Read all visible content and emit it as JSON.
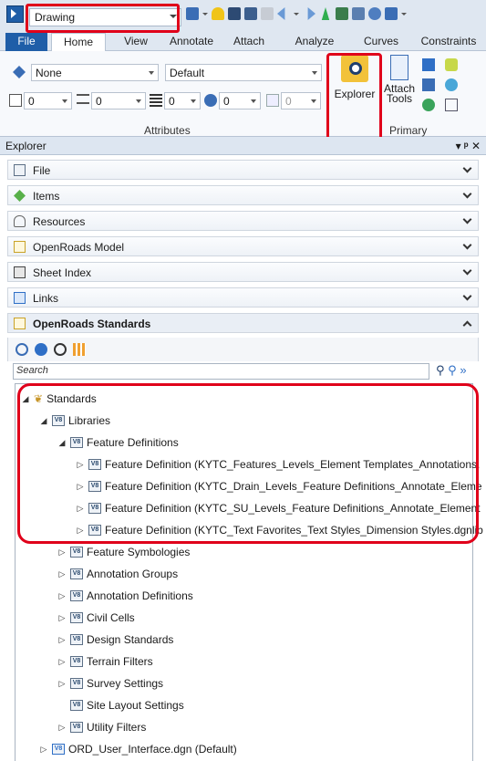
{
  "workspace": {
    "selected": "Drawing"
  },
  "ribbon_tabs": [
    "File",
    "Home",
    "View",
    "Annotate",
    "Attach",
    "Analyze",
    "Curves",
    "Constraints"
  ],
  "ribbon": {
    "level_value": "None",
    "style_value": "Default",
    "small_values": [
      "0",
      "0",
      "0",
      "0",
      "0"
    ],
    "group_attributes": "Attributes",
    "group_primary": "Primary",
    "explorer_label": "Explorer",
    "attach_tools_label1": "Attach",
    "attach_tools_label2": "Tools"
  },
  "explorer": {
    "title": "Explorer",
    "title_controls": "▾ ᵖ ✕",
    "sections": [
      "File",
      "Items",
      "Resources",
      "OpenRoads Model",
      "Sheet Index",
      "Links",
      "OpenRoads Standards"
    ],
    "search_placeholder": "Search"
  },
  "tree": {
    "root": "Standards",
    "libraries": "Libraries",
    "feature_definitions": "Feature Definitions",
    "fd_items": [
      "Feature Definition (KYTC_Features_Levels_Element Templates_Annotations.",
      "Feature Definition (KYTC_Drain_Levels_Feature Definitions_Annotate_Eleme",
      "Feature Definition (KYTC_SU_Levels_Feature Definitions_Annotate_Element",
      "Feature Definition (KYTC_Text Favorites_Text Styles_Dimension Styles.dgnlib"
    ],
    "other_libs": [
      "Feature Symbologies",
      "Annotation Groups",
      "Annotation Definitions",
      "Civil Cells",
      "Design Standards",
      "Terrain Filters",
      "Survey Settings",
      "Site Layout Settings",
      "Utility Filters"
    ],
    "file_node": "ORD_User_Interface.dgn (Default)"
  },
  "colors": {
    "highlight": "#e0001a",
    "accent": "#1f5ea8"
  }
}
